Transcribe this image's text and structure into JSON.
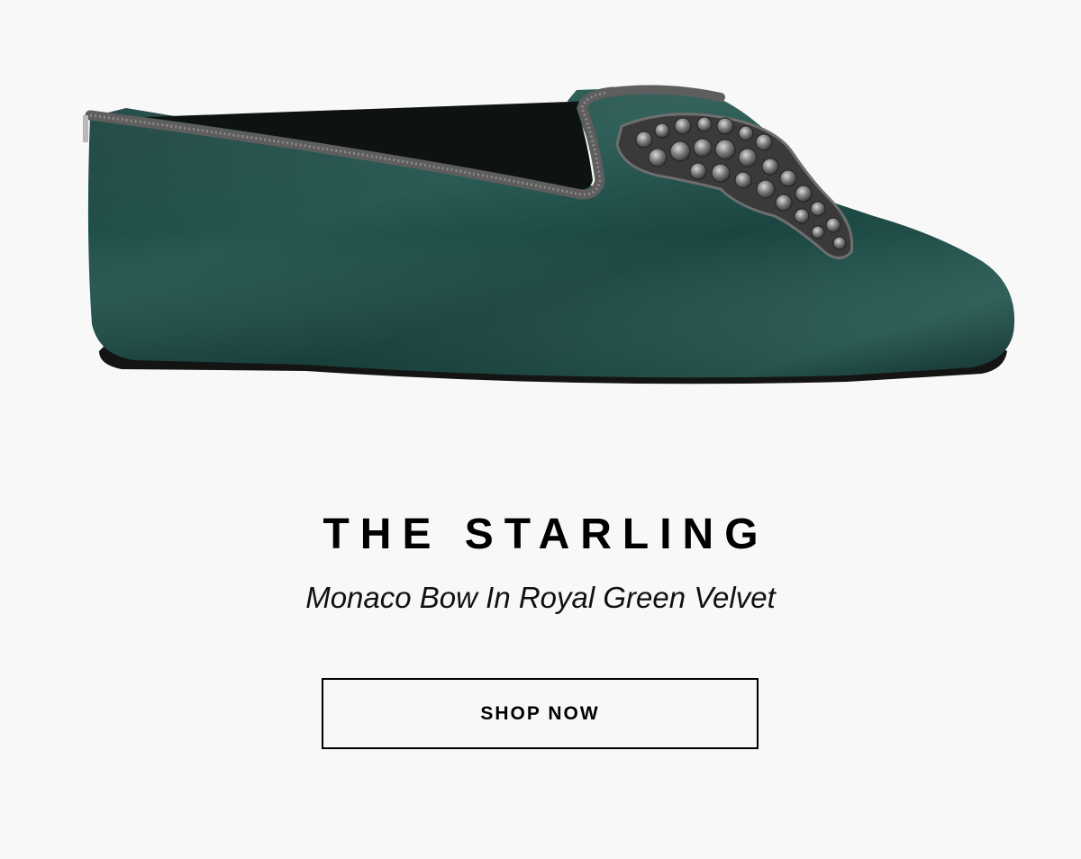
{
  "product": {
    "title": "THE STARLING",
    "subtitle": "Monaco Bow In Royal Green Velvet",
    "image_name": "green-velvet-loafer-with-jeweled-bow"
  },
  "cta": {
    "label": "SHOP NOW"
  },
  "colors": {
    "background": "#f8f8f8",
    "velvet_green": "#1e4a44",
    "trim_gray": "#5e5e5e",
    "text": "#000000"
  }
}
